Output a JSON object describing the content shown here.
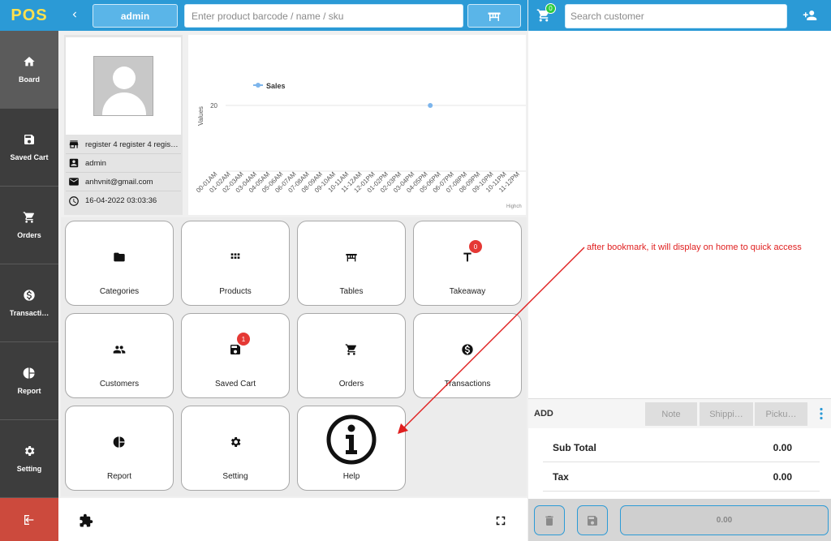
{
  "app": {
    "logo": "POS"
  },
  "sidebar": {
    "items": [
      {
        "label": "Board",
        "icon": "home-icon",
        "active": true
      },
      {
        "label": "Saved Cart",
        "icon": "save-icon"
      },
      {
        "label": "Orders",
        "icon": "cart-icon"
      },
      {
        "label": "Transacti…",
        "icon": "dollar-icon"
      },
      {
        "label": "Report",
        "icon": "pie-chart-icon"
      },
      {
        "label": "Setting",
        "icon": "gear-icon"
      }
    ],
    "logout_icon": "logout-icon"
  },
  "topbar": {
    "user_button": "admin",
    "search_placeholder": "Enter product barcode / name / sku",
    "table_icon": "table-icon"
  },
  "info": {
    "register": "register 4 register 4 regis…",
    "user": "admin",
    "email": "anhvnit@gmail.com",
    "datetime": "16-04-2022 03:03:36"
  },
  "chart_data": {
    "type": "line",
    "legend": "Sales",
    "ylabel": "Values",
    "yticks": [
      20
    ],
    "categories": [
      "00-01AM",
      "01-02AM",
      "02-03AM",
      "03-04AM",
      "04-05AM",
      "05-06AM",
      "06-07AM",
      "07-08AM",
      "08-09AM",
      "09-10AM",
      "10-11AM",
      "11-12AM",
      "12-01PM",
      "01-02PM",
      "02-03PM",
      "03-04PM",
      "04-05PM",
      "05-06PM",
      "06-07PM",
      "07-08PM",
      "08-09PM",
      "09-10PM",
      "10-11PM",
      "11-12PM"
    ],
    "series": [
      {
        "name": "Sales",
        "points": [
          {
            "x": "04-05PM",
            "y": 20
          }
        ]
      }
    ],
    "credit": "Highch",
    "legend_color": "#7cb5ec"
  },
  "tiles": [
    {
      "label": "Categories",
      "icon": "folder-icon"
    },
    {
      "label": "Products",
      "icon": "grid-icon"
    },
    {
      "label": "Tables",
      "icon": "table-icon"
    },
    {
      "label": "Takeaway",
      "icon": "takeaway-icon",
      "badge": "0"
    },
    {
      "label": "Customers",
      "icon": "people-icon"
    },
    {
      "label": "Saved Cart",
      "icon": "save-icon",
      "badge": "1"
    },
    {
      "label": "Orders",
      "icon": "cart-icon"
    },
    {
      "label": "Transactions",
      "icon": "dollar-icon"
    },
    {
      "label": "Report",
      "icon": "pie-chart-icon"
    },
    {
      "label": "Setting",
      "icon": "gear-icon"
    },
    {
      "label": "Help",
      "icon": "info-icon"
    }
  ],
  "bottom": {
    "left_icon": "puzzle-icon",
    "right_icon": "fullscreen-icon"
  },
  "annotation": {
    "text": "after bookmark, it will display on home to quick access",
    "color": "#e02020"
  },
  "cart": {
    "count": "0",
    "customer_placeholder": "Search customer",
    "add_label": "ADD",
    "buttons": [
      "Note",
      "Shippi…",
      "Picku…"
    ],
    "subtotal_label": "Sub Total",
    "subtotal_value": "0.00",
    "tax_label": "Tax",
    "tax_value": "0.00",
    "pay_value": "0.00"
  },
  "colors": {
    "primary": "#2b9ad6",
    "sidebar": "#3d3d3d",
    "logout": "#cc4a3d",
    "badge": "#e53935",
    "cart_badge": "#2ecc40",
    "logo_text": "#ffe14d"
  }
}
